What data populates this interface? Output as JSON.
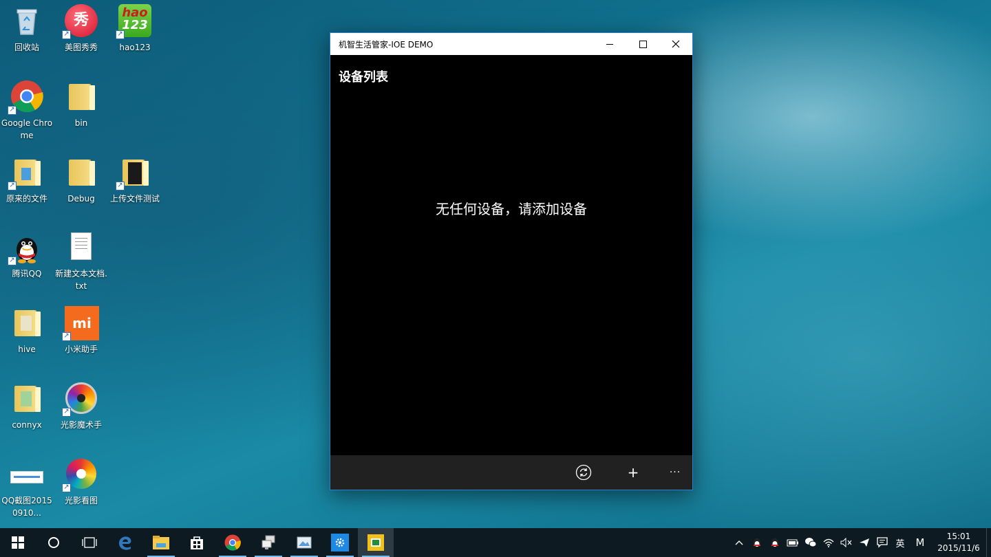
{
  "desktop": {
    "icons": [
      {
        "label": "回收站"
      },
      {
        "label": "美图秀秀"
      },
      {
        "label": "hao123"
      },
      {
        "label": "Google Chrome"
      },
      {
        "label": "bin"
      },
      {
        "label": "原来的文件"
      },
      {
        "label": "Debug"
      },
      {
        "label": "上传文件测试"
      },
      {
        "label": "腾讯QQ"
      },
      {
        "label": "新建文本文档.txt"
      },
      {
        "label": "hive"
      },
      {
        "label": "小米助手"
      },
      {
        "label": "connyx"
      },
      {
        "label": "光影魔术手"
      },
      {
        "label": "QQ截图20150910..."
      },
      {
        "label": "光影看图"
      }
    ],
    "glyphs": {
      "meitu": "秀",
      "hao": "hao",
      "hao_num": "123",
      "mi": "mi"
    }
  },
  "window": {
    "title": "机智生活管家-IOE DEMO",
    "page_title": "设备列表",
    "empty_message": "无任何设备，请添加设备",
    "commands": {
      "refresh_icon": "refresh-icon",
      "add_label": "+",
      "more_label": "···"
    }
  },
  "taskbar": {
    "tray": {
      "chevron": "^",
      "ime_label": "英",
      "m_label": "M",
      "time": "15:01",
      "date": "2015/11/6"
    }
  },
  "colors": {
    "window_border": "#2d7fd0",
    "command_bar": "#212121",
    "taskbar": "#0d1a22",
    "accent": "#76b9ed"
  }
}
